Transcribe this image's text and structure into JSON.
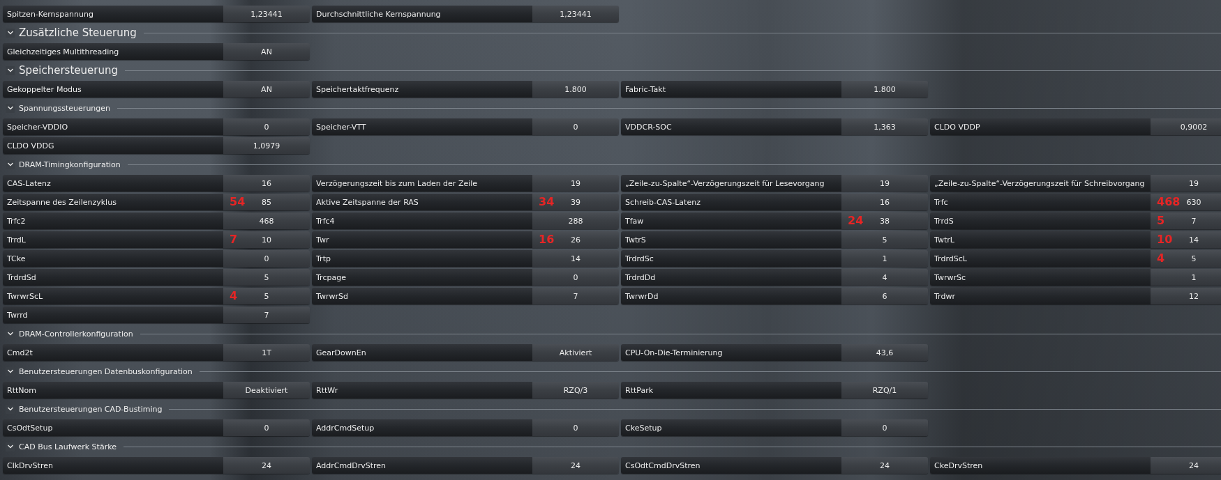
{
  "sections": [
    {
      "kind": "none",
      "cells": [
        {
          "label": "Spitzen-Kernspannung",
          "value": "1,23441"
        },
        {
          "label": "Durchschnittliche Kernspannung",
          "value": "1,23441"
        }
      ]
    },
    {
      "kind": "major",
      "title": "Zusätzliche Steuerung",
      "expanded": true,
      "cells": [
        {
          "label": "Gleichzeitiges Multithreading",
          "value": "AN"
        }
      ]
    },
    {
      "kind": "major",
      "title": "Speichersteuerung",
      "expanded": true,
      "cells": [
        {
          "label": "Gekoppelter Modus",
          "value": "AN"
        },
        {
          "label": "Speichertaktfrequenz",
          "value": "1.800"
        },
        {
          "label": "Fabric-Takt",
          "value": "1.800"
        }
      ]
    },
    {
      "kind": "minor",
      "title": "Spannungssteuerungen",
      "expanded": true,
      "cells": [
        {
          "label": "Speicher-VDDIO",
          "value": "0"
        },
        {
          "label": "Speicher-VTT",
          "value": "0"
        },
        {
          "label": "VDDCR-SOC",
          "value": "1,363"
        },
        {
          "label": "CLDO VDDP",
          "value": "0,9002"
        },
        {
          "label": "CLDO VDDG",
          "value": "1,0979"
        }
      ]
    },
    {
      "kind": "minor",
      "title": "DRAM-Timingkonfiguration",
      "expanded": true,
      "cells": [
        {
          "label": "CAS-Latenz",
          "value": "16"
        },
        {
          "label": "Verzögerungszeit bis zum Laden der Zeile",
          "value": "19"
        },
        {
          "label": "„Zeile-zu-Spalte“-Verzögerungszeit für Lesevorgang",
          "value": "19"
        },
        {
          "label": "„Zeile-zu-Spalte“-Verzögerungszeit für Schreibvorgang",
          "value": "19"
        },
        {
          "label": "Zeitspanne des Zeilenzyklus",
          "value": "85",
          "annotation": "54"
        },
        {
          "label": "Aktive Zeitspanne der RAS",
          "value": "39",
          "annotation": "34"
        },
        {
          "label": "Schreib-CAS-Latenz",
          "value": "16"
        },
        {
          "label": "Trfc",
          "value": "630",
          "annotation": "468"
        },
        {
          "label": "Trfc2",
          "value": "468"
        },
        {
          "label": "Trfc4",
          "value": "288"
        },
        {
          "label": "Tfaw",
          "value": "38",
          "annotation": "24"
        },
        {
          "label": "TrrdS",
          "value": "7",
          "annotation": "5"
        },
        {
          "label": "TrrdL",
          "value": "10",
          "annotation": "7"
        },
        {
          "label": "Twr",
          "value": "26",
          "annotation": "16"
        },
        {
          "label": "TwtrS",
          "value": "5"
        },
        {
          "label": "TwtrL",
          "value": "14",
          "annotation": "10"
        },
        {
          "label": "TCke",
          "value": "0"
        },
        {
          "label": "Trtp",
          "value": "14"
        },
        {
          "label": "TrdrdSc",
          "value": "1"
        },
        {
          "label": "TrdrdScL",
          "value": "5",
          "annotation": "4"
        },
        {
          "label": "TrdrdSd",
          "value": "5"
        },
        {
          "label": "Trcpage",
          "value": "0"
        },
        {
          "label": "TrdrdDd",
          "value": "4"
        },
        {
          "label": "TwrwrSc",
          "value": "1"
        },
        {
          "label": "TwrwrScL",
          "value": "5",
          "annotation": "4"
        },
        {
          "label": "TwrwrSd",
          "value": "7"
        },
        {
          "label": "TwrwrDd",
          "value": "6"
        },
        {
          "label": "Trdwr",
          "value": "12"
        },
        {
          "label": "Twrrd",
          "value": "7"
        }
      ]
    },
    {
      "kind": "minor",
      "title": "DRAM-Controllerkonfiguration",
      "expanded": true,
      "cells": [
        {
          "label": "Cmd2t",
          "value": "1T"
        },
        {
          "label": "GearDownEn",
          "value": "Aktiviert"
        },
        {
          "label": "CPU-On-Die-Terminierung",
          "value": "43,6"
        }
      ]
    },
    {
      "kind": "minor",
      "title": "Benutzersteuerungen Datenbuskonfiguration",
      "expanded": true,
      "cells": [
        {
          "label": "RttNom",
          "value": "Deaktiviert"
        },
        {
          "label": "RttWr",
          "value": "RZQ/3"
        },
        {
          "label": "RttPark",
          "value": "RZQ/1"
        }
      ]
    },
    {
      "kind": "minor",
      "title": "Benutzersteuerungen CAD-Bustiming",
      "expanded": true,
      "cells": [
        {
          "label": "CsOdtSetup",
          "value": "0"
        },
        {
          "label": "AddrCmdSetup",
          "value": "0"
        },
        {
          "label": "CkeSetup",
          "value": "0"
        }
      ]
    },
    {
      "kind": "minor",
      "title": "CAD Bus Laufwerk Stärke",
      "expanded": true,
      "cells": [
        {
          "label": "ClkDrvStren",
          "value": "24"
        },
        {
          "label": "AddrCmdDrvStren",
          "value": "24"
        },
        {
          "label": "CsOdtCmdDrvStren",
          "value": "24"
        },
        {
          "label": "CkeDrvStren",
          "value": "24"
        }
      ]
    }
  ]
}
